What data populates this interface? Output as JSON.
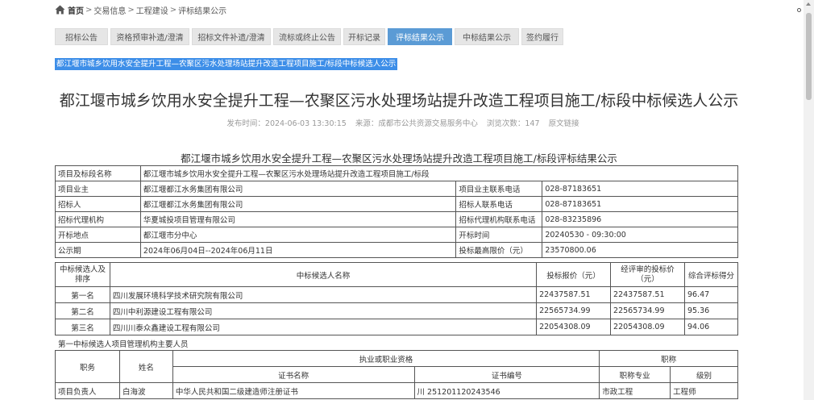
{
  "breadcrumb": {
    "home": "首页",
    "sep": ">",
    "items": [
      "交易信息",
      "工程建设",
      "评标结果公示"
    ]
  },
  "tabs": [
    {
      "label": "招标公告",
      "width": 66
    },
    {
      "label": "资格预审补遗/澄清",
      "width": 98
    },
    {
      "label": "招标文件补遗/澄清",
      "width": 98
    },
    {
      "label": "流标或终止公告",
      "width": 84
    },
    {
      "label": "开标记录",
      "width": 52
    },
    {
      "label": "评标结果公示",
      "width": 80,
      "active": true
    },
    {
      "label": "中标结果公示",
      "width": 80
    },
    {
      "label": "签约履行",
      "width": 52
    }
  ],
  "selected_link": "都江堰市城乡饮用水安全提升工程—农聚区污水处理场站提升改造工程项目施工/标段中标候选人公示",
  "article": {
    "title": "都江堰市城乡饮用水安全提升工程—农聚区污水处理场站提升改造工程项目施工/标段中标候选人公示",
    "publish_time": "发布时间：2024-06-03 13:30:15",
    "source": "来源：成都市公共资源交易服务中心",
    "views": "浏览次数：147",
    "original_link": "原文链接"
  },
  "result_title": "都江堰市城乡饮用水安全提升工程—农聚区污水处理场站提升改造工程项目施工/标段评标结果公示",
  "info": {
    "project_label": "项目及标段名称",
    "project_value": "都江堰市城乡饮用水安全提升工程—农聚区污水处理场站提升改造工程项目施工/标段",
    "owner_label": "项目业主",
    "owner_value": "都江堰都江水务集团有限公司",
    "owner_phone_label": "项目业主联系电话",
    "owner_phone_value": "028-87183651",
    "tenderer_label": "招标人",
    "tenderer_value": "都江堰都江水务集团有限公司",
    "tenderer_phone_label": "招标人联系电话",
    "tenderer_phone_value": "028-87183651",
    "agency_label": "招标代理机构",
    "agency_value": "华夏城投项目管理有限公司",
    "agency_phone_label": "招标代理机构联系电话",
    "agency_phone_value": "028-83235896",
    "venue_label": "开标地点",
    "venue_value": "都江堰市分中心",
    "open_time_label": "开标时间",
    "open_time_value": "20240530 - 09:30:00",
    "period_label": "公示期",
    "period_value": "2024年06月04日--2024年06月11日",
    "max_price_label": "投标最高限价（元）",
    "max_price_value": "23570800.06"
  },
  "ranking": {
    "headers": {
      "rank": "中标候选人及排序",
      "name": "中标候选人名称",
      "bid": "投标报价（元）",
      "corrected": "经评审的投标价（元）",
      "score": "综合评标得分"
    },
    "rows": [
      {
        "rank": "第一名",
        "name": "四川发展环境科学技术研究院有限公司",
        "bid": "22437587.51",
        "corrected": "22437587.51",
        "score": "96.47"
      },
      {
        "rank": "第二名",
        "name": "四川中利源建设工程有限公司",
        "bid": "22565734.99",
        "corrected": "22565734.99",
        "score": "95.36"
      },
      {
        "rank": "第三名",
        "name": "四川川泰众鑫建设工程有限公司",
        "bid": "22054308.09",
        "corrected": "22054308.09",
        "score": "94.06"
      }
    ]
  },
  "staff": {
    "group_title": "第一中标候选人项目管理机构主要人员",
    "headers": {
      "duty": "职务",
      "name": "姓名",
      "qualification": "执业或职业资格",
      "title": "职称",
      "cert_name": "证书名称",
      "cert_no": "证书编号",
      "major": "职称专业",
      "level": "级别"
    },
    "rows": [
      {
        "duty": "项目负责人",
        "name": "白海波",
        "cert_name": "中华人民共和国二级建造师注册证书",
        "cert_no": "川 251201120243546",
        "major": "市政工程",
        "level": "工程师"
      }
    ]
  }
}
